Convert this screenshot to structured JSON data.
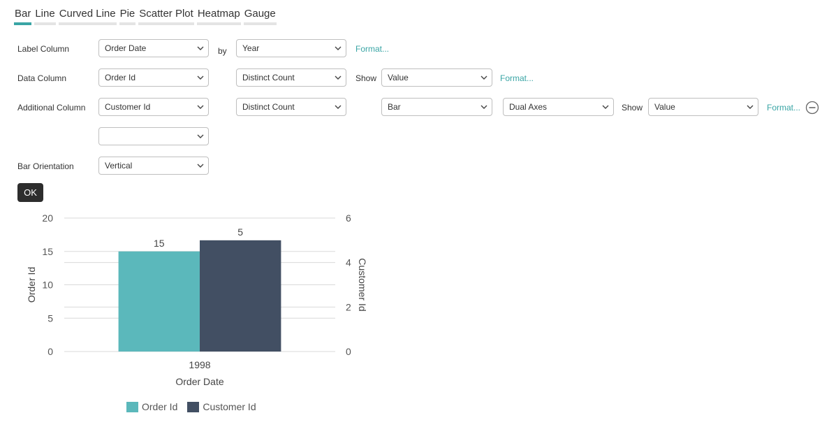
{
  "tabs": [
    {
      "label": "Bar",
      "active": true
    },
    {
      "label": "Line"
    },
    {
      "label": "Curved Line"
    },
    {
      "label": "Pie"
    },
    {
      "label": "Scatter Plot"
    },
    {
      "label": "Heatmap"
    },
    {
      "label": "Gauge"
    }
  ],
  "form": {
    "label_column": {
      "label": "Label Column",
      "value": "Order Date",
      "by_label": "by",
      "by_value": "Year",
      "format_link": "Format..."
    },
    "data_column": {
      "label": "Data Column",
      "value": "Order Id",
      "aggregate": "Distinct Count",
      "show_label": "Show",
      "show_value": "Value",
      "format_link": "Format..."
    },
    "additional_column": {
      "label": "Additional Column",
      "value": "Customer Id",
      "aggregate": "Distinct Count",
      "chart_type": "Bar",
      "axes": "Dual Axes",
      "show_label": "Show",
      "show_value": "Value",
      "format_link": "Format..."
    },
    "extra_column": {
      "value": ""
    },
    "bar_orientation": {
      "label": "Bar Orientation",
      "value": "Vertical"
    },
    "ok_label": "OK"
  },
  "colors": {
    "accent": "#3aa5a5",
    "series1": "#5bb8bb",
    "series2": "#424f63"
  },
  "chart_data": {
    "type": "bar",
    "categories": [
      "1998"
    ],
    "series": [
      {
        "name": "Order Id",
        "values": [
          15
        ],
        "axis": "left",
        "color": "#5bb8bb"
      },
      {
        "name": "Customer Id",
        "values": [
          5
        ],
        "axis": "right",
        "color": "#424f63"
      }
    ],
    "xlabel": "Order Date",
    "ylabel": "Order Id",
    "y2label": "Customer Id",
    "ylim": [
      0,
      20
    ],
    "y2lim": [
      0,
      6
    ],
    "yticks": [
      0,
      5,
      10,
      15,
      20
    ],
    "y2ticks": [
      0,
      2,
      4,
      6
    ],
    "grid": true,
    "legend": "bottom"
  }
}
